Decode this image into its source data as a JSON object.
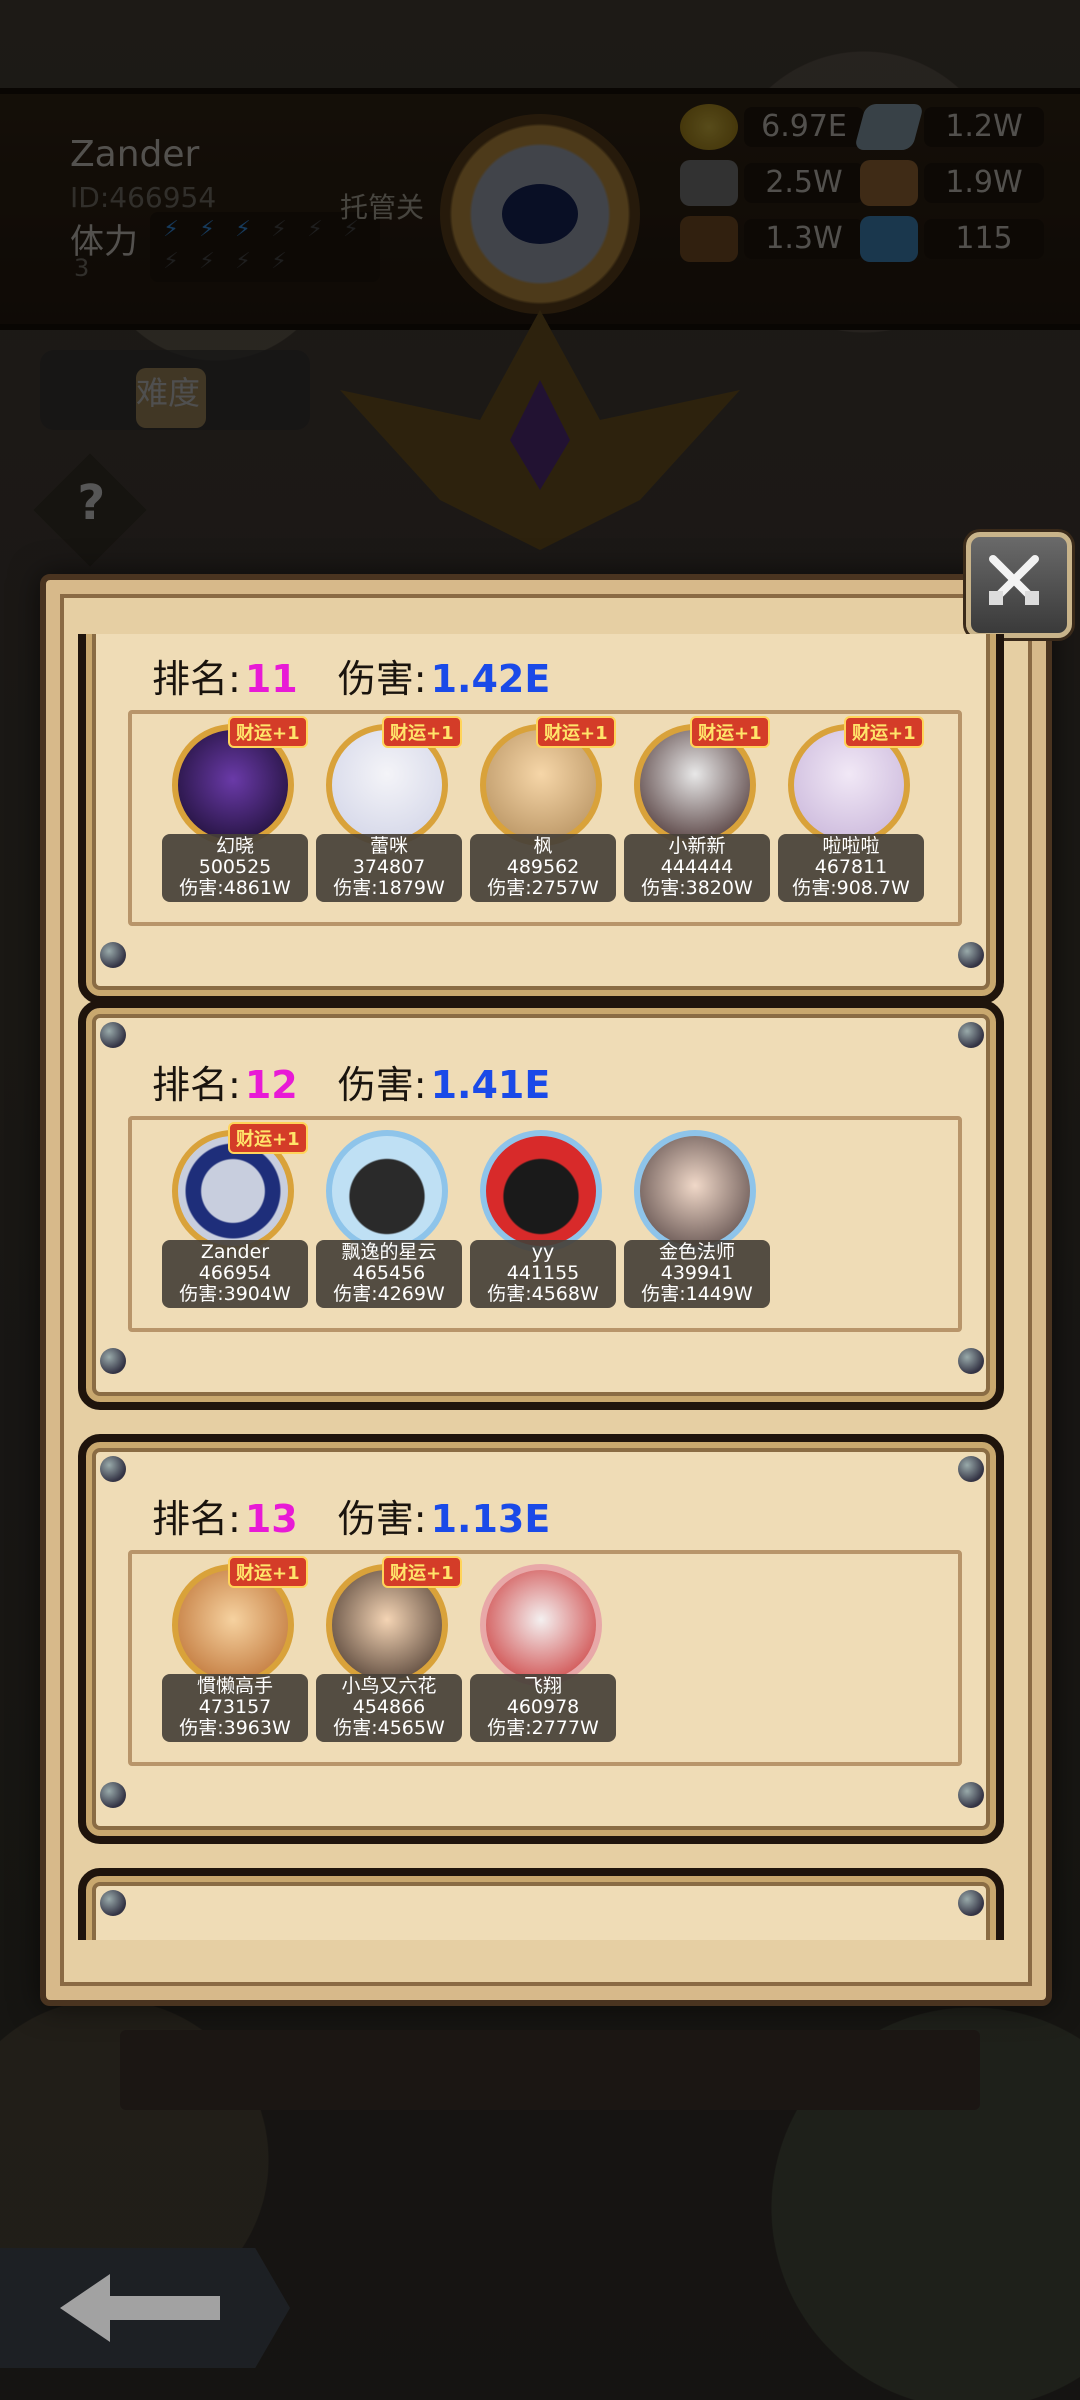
{
  "player": {
    "name": "Zander",
    "id": "ID:466954",
    "stamina_label": "体力",
    "stamina_value": "3",
    "stamina_bolts_active": 3,
    "stamina_bolts_total": 10,
    "auto_label": "托管关"
  },
  "resources": {
    "gold": "6.97E",
    "crystal": "1.2W",
    "ore": "2.5W",
    "leather": "1.9W",
    "wood": "1.3W",
    "gem": "115"
  },
  "difficulty_label": "难度",
  "help_label": "?",
  "ranks": [
    {
      "rank_label": "排名:",
      "rank": "11",
      "damage_label": "伤害:",
      "damage": "1.42E",
      "heroes": [
        {
          "name": "幻晓",
          "id": "500525",
          "damage": "伤害:4861W",
          "badge": "财运+1"
        },
        {
          "name": "蕾咪",
          "id": "374807",
          "damage": "伤害:1879W",
          "badge": "财运+1"
        },
        {
          "name": "枫",
          "id": "489562",
          "damage": "伤害:2757W",
          "badge": "财运+1"
        },
        {
          "name": "小新新",
          "id": "444444",
          "damage": "伤害:3820W",
          "badge": "财运+1"
        },
        {
          "name": "啦啦啦",
          "id": "467811",
          "damage": "伤害:908.7W",
          "badge": "财运+1"
        }
      ]
    },
    {
      "rank_label": "排名:",
      "rank": "12",
      "damage_label": "伤害:",
      "damage": "1.41E",
      "heroes": [
        {
          "name": "Zander",
          "id": "466954",
          "damage": "伤害:3904W",
          "badge": "财运+1"
        },
        {
          "name": "飘逸的星云",
          "id": "465456",
          "damage": "伤害:4269W",
          "badge": ""
        },
        {
          "name": "yy",
          "id": "441155",
          "damage": "伤害:4568W",
          "badge": ""
        },
        {
          "name": "金色法师",
          "id": "439941",
          "damage": "伤害:1449W",
          "badge": ""
        }
      ]
    },
    {
      "rank_label": "排名:",
      "rank": "13",
      "damage_label": "伤害:",
      "damage": "1.13E",
      "heroes": [
        {
          "name": "慣懒高手",
          "id": "473157",
          "damage": "伤害:3963W",
          "badge": "财运+1"
        },
        {
          "name": "小鸟又六花",
          "id": "454866",
          "damage": "伤害:4565W",
          "badge": "财运+1"
        },
        {
          "name": "飞翔",
          "id": "460978",
          "damage": "伤害:2777W",
          "badge": ""
        }
      ]
    }
  ],
  "colors": {
    "rank_number": "#e81ad6",
    "damage_value": "#1a4ae8",
    "parchment": "#efdcb6",
    "frame_dark": "#1f140c"
  },
  "icons": {
    "close": "crossed-swords-close-icon",
    "back": "back-arrow-icon",
    "help": "question-mark-icon"
  }
}
